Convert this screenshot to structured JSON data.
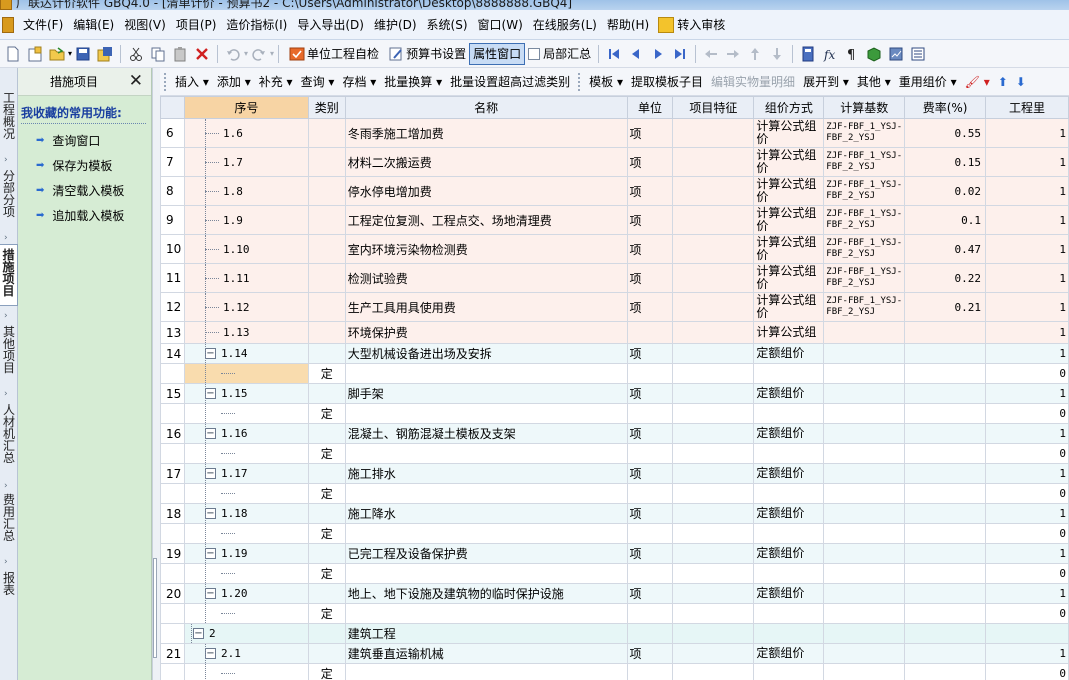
{
  "title_bar": {
    "text": "广联达计价软件 GBQ4.0 - [清单计价 - 预算书2 - C:\\Users\\Administrator\\Desktop\\8888888.GBQ4]"
  },
  "menu": {
    "items": [
      "文件(F)",
      "编辑(E)",
      "视图(V)",
      "项目(P)",
      "造价指标(I)",
      "导入导出(D)",
      "维护(D)",
      "系统(S)",
      "窗口(W)",
      "在线服务(L)",
      "帮助(H)"
    ],
    "audit_label": "转入审核"
  },
  "toolbar1": {
    "self_check_label": "单位工程自检",
    "budget_settings_label": "预算书设置",
    "property_window_label": "属性窗口",
    "partial_summary_label": "局部汇总"
  },
  "toolbar2": {
    "items": [
      "插入",
      "添加",
      "补充",
      "查询",
      "存档",
      "批量换算",
      "批量设置超高过滤类别",
      "模板",
      "提取模板子目",
      "编辑实物量明细",
      "展开到",
      "其他",
      "重用组价"
    ]
  },
  "left_tabs": [
    "工程概况",
    "分部分项",
    "措施项目",
    "其他项目",
    "人材机汇总",
    "费用汇总",
    "报表"
  ],
  "side_panel": {
    "title": "措施项目",
    "section_title": "我收藏的常用功能:",
    "links": [
      "查询窗口",
      "保存为模板",
      "清空载入模板",
      "追加载入模板"
    ]
  },
  "grid": {
    "headers": [
      "序号",
      "类别",
      "名称",
      "单位",
      "项目特征",
      "组价方式",
      "计算基数",
      "费率(%)",
      "工程里"
    ],
    "rows": [
      {
        "type": "rate",
        "no": "6",
        "seq": "1.6",
        "cat": "",
        "name": "冬雨季施工增加费",
        "unit": "项",
        "feature": "",
        "method": "计算公式组价",
        "basis": "ZJF-FBF_1_YSJ-FBF_2_YSJ",
        "rate": "0.55",
        "qty": "1"
      },
      {
        "type": "rate",
        "no": "7",
        "seq": "1.7",
        "cat": "",
        "name": "材料二次搬运费",
        "unit": "项",
        "feature": "",
        "method": "计算公式组价",
        "basis": "ZJF-FBF_1_YSJ-FBF_2_YSJ",
        "rate": "0.15",
        "qty": "1"
      },
      {
        "type": "rate",
        "no": "8",
        "seq": "1.8",
        "cat": "",
        "name": "停水停电增加费",
        "unit": "项",
        "feature": "",
        "method": "计算公式组价",
        "basis": "ZJF-FBF_1_YSJ-FBF_2_YSJ",
        "rate": "0.02",
        "qty": "1"
      },
      {
        "type": "rate",
        "no": "9",
        "seq": "1.9",
        "cat": "",
        "name": "工程定位复测、工程点交、场地清理费",
        "unit": "项",
        "feature": "",
        "method": "计算公式组价",
        "basis": "ZJF-FBF_1_YSJ-FBF_2_YSJ",
        "rate": "0.1",
        "qty": "1"
      },
      {
        "type": "rate",
        "no": "10",
        "seq": "1.10",
        "cat": "",
        "name": "室内环境污染物检测费",
        "unit": "项",
        "feature": "",
        "method": "计算公式组价",
        "basis": "ZJF-FBF_1_YSJ-FBF_2_YSJ",
        "rate": "0.47",
        "qty": "1"
      },
      {
        "type": "rate",
        "no": "11",
        "seq": "1.11",
        "cat": "",
        "name": "检测试验费",
        "unit": "项",
        "feature": "",
        "method": "计算公式组价",
        "basis": "ZJF-FBF_1_YSJ-FBF_2_YSJ",
        "rate": "0.22",
        "qty": "1"
      },
      {
        "type": "rate",
        "no": "12",
        "seq": "1.12",
        "cat": "",
        "name": "生产工具用具使用费",
        "unit": "项",
        "feature": "",
        "method": "计算公式组价",
        "basis": "ZJF-FBF_1_YSJ-FBF_2_YSJ",
        "rate": "0.21",
        "qty": "1"
      },
      {
        "type": "rate",
        "no": "13",
        "seq": "1.13",
        "cat": "",
        "name": "环境保护费",
        "unit": "",
        "feature": "",
        "method": "计算公式组",
        "basis": "",
        "rate": "",
        "qty": "1"
      },
      {
        "type": "def",
        "no": "14",
        "seq": "1.14",
        "cat": "",
        "name": "大型机械设备进出场及安拆",
        "unit": "项",
        "feature": "",
        "method": "定额组价",
        "basis": "",
        "rate": "",
        "qty": "1"
      },
      {
        "type": "sub",
        "no": "",
        "seq": "",
        "cat": "定",
        "name": "",
        "unit": "",
        "feature": "",
        "method": "",
        "basis": "",
        "rate": "",
        "qty": "0",
        "selected": true
      },
      {
        "type": "def",
        "no": "15",
        "seq": "1.15",
        "cat": "",
        "name": "脚手架",
        "unit": "项",
        "feature": "",
        "method": "定额组价",
        "basis": "",
        "rate": "",
        "qty": "1"
      },
      {
        "type": "sub",
        "no": "",
        "seq": "",
        "cat": "定",
        "name": "",
        "unit": "",
        "feature": "",
        "method": "",
        "basis": "",
        "rate": "",
        "qty": "0"
      },
      {
        "type": "def",
        "no": "16",
        "seq": "1.16",
        "cat": "",
        "name": "混凝土、钢筋混凝土模板及支架",
        "unit": "项",
        "feature": "",
        "method": "定额组价",
        "basis": "",
        "rate": "",
        "qty": "1"
      },
      {
        "type": "sub",
        "no": "",
        "seq": "",
        "cat": "定",
        "name": "",
        "unit": "",
        "feature": "",
        "method": "",
        "basis": "",
        "rate": "",
        "qty": "0"
      },
      {
        "type": "def",
        "no": "17",
        "seq": "1.17",
        "cat": "",
        "name": "施工排水",
        "unit": "项",
        "feature": "",
        "method": "定额组价",
        "basis": "",
        "rate": "",
        "qty": "1"
      },
      {
        "type": "sub",
        "no": "",
        "seq": "",
        "cat": "定",
        "name": "",
        "unit": "",
        "feature": "",
        "method": "",
        "basis": "",
        "rate": "",
        "qty": "0"
      },
      {
        "type": "def",
        "no": "18",
        "seq": "1.18",
        "cat": "",
        "name": "施工降水",
        "unit": "项",
        "feature": "",
        "method": "定额组价",
        "basis": "",
        "rate": "",
        "qty": "1"
      },
      {
        "type": "sub",
        "no": "",
        "seq": "",
        "cat": "定",
        "name": "",
        "unit": "",
        "feature": "",
        "method": "",
        "basis": "",
        "rate": "",
        "qty": "0"
      },
      {
        "type": "def",
        "no": "19",
        "seq": "1.19",
        "cat": "",
        "name": "已完工程及设备保护费",
        "unit": "项",
        "feature": "",
        "method": "定额组价",
        "basis": "",
        "rate": "",
        "qty": "1"
      },
      {
        "type": "sub",
        "no": "",
        "seq": "",
        "cat": "定",
        "name": "",
        "unit": "",
        "feature": "",
        "method": "",
        "basis": "",
        "rate": "",
        "qty": "0"
      },
      {
        "type": "def",
        "no": "20",
        "seq": "1.20",
        "cat": "",
        "name": "地上、地下设施及建筑物的临时保护设施",
        "unit": "项",
        "feature": "",
        "method": "定额组价",
        "basis": "",
        "rate": "",
        "qty": "1"
      },
      {
        "type": "sub",
        "no": "",
        "seq": "",
        "cat": "定",
        "name": "",
        "unit": "",
        "feature": "",
        "method": "",
        "basis": "",
        "rate": "",
        "qty": "0"
      },
      {
        "type": "sect",
        "no": "",
        "seq": "2",
        "cat": "",
        "name": "建筑工程",
        "unit": "",
        "feature": "",
        "method": "",
        "basis": "",
        "rate": "",
        "qty": ""
      },
      {
        "type": "def",
        "no": "21",
        "seq": "2.1",
        "cat": "",
        "name": "建筑垂直运输机械",
        "unit": "项",
        "feature": "",
        "method": "定额组价",
        "basis": "",
        "rate": "",
        "qty": "1"
      },
      {
        "type": "sub",
        "no": "",
        "seq": "",
        "cat": "定",
        "name": "",
        "unit": "",
        "feature": "",
        "method": "",
        "basis": "",
        "rate": "",
        "qty": "0"
      }
    ]
  }
}
